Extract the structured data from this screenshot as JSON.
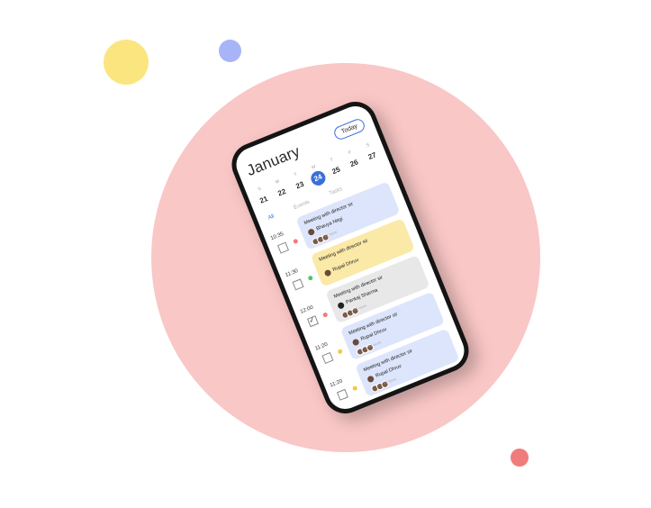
{
  "colors": {
    "accent": "#3b6fd8",
    "pink": "#f9c7c6",
    "yellow": "#fbe57f",
    "blue": "#a7b4f7",
    "red": "#f07b7b"
  },
  "header": {
    "month": "January",
    "today_label": "Today"
  },
  "week": [
    {
      "name": "S",
      "date": "21"
    },
    {
      "name": "M",
      "date": "22"
    },
    {
      "name": "T",
      "date": "23"
    },
    {
      "name": "W",
      "date": "24",
      "selected": true
    },
    {
      "name": "T",
      "date": "25"
    },
    {
      "name": "F",
      "date": "26"
    },
    {
      "name": "S",
      "date": "27"
    }
  ],
  "tabs": [
    "All",
    "Events",
    "Tasks"
  ],
  "events": [
    {
      "time": "10:35",
      "title": "Meeting with director sir",
      "person": "Bhavya Negi",
      "more": "+2 more",
      "checked": false,
      "dot": "#f07b7b",
      "card": "#dce5fb"
    },
    {
      "time": "11:30",
      "title": "Meeting with director sir",
      "person": "Rupal Dhruv",
      "more": "",
      "checked": false,
      "dot": "#4cc764",
      "card": "#fbe9a8"
    },
    {
      "time": "12:00",
      "title": "Meeting with director sir",
      "person": "Pankaj Sharma",
      "more": "+2 more",
      "checked": true,
      "dot": "#f07b7b",
      "card": "#e8e8e8"
    },
    {
      "time": "11:20",
      "title": "Meeting with director sir",
      "person": "Rupal Dhruv",
      "more": "+2 more",
      "checked": false,
      "dot": "#f5c842",
      "card": "#dce5fb"
    },
    {
      "time": "11:20",
      "title": "Meeting with director sir",
      "person": "Rupal Dhruv",
      "more": "+2 more",
      "checked": false,
      "dot": "#f5c842",
      "card": "#dce5fb"
    }
  ]
}
